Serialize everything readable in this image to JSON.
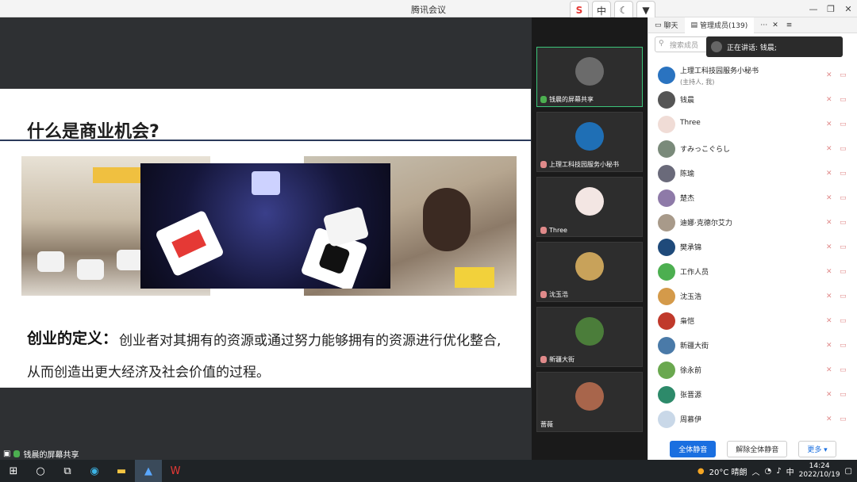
{
  "app_title": "腾讯会议",
  "toolbar_icons": [
    "s-icon",
    "中",
    "moon-icon",
    "shirt-icon"
  ],
  "window_controls": [
    "—",
    "❐",
    "✕"
  ],
  "slide": {
    "title": "什么是商业机会?",
    "def_label": "创业的定义：",
    "def_text": "创业者对其拥有的资源或通过努力能够拥有的资源进行优化整合,",
    "def_text2": "从而创造出更大经济及社会价值的过程。"
  },
  "video_tiles": [
    {
      "name": "钱晨的屏幕共享",
      "active": true,
      "color": "#6b6b6b"
    },
    {
      "name": "上理工科技园服务小秘书",
      "active": false,
      "color": "#1f6fb5"
    },
    {
      "name": "Three",
      "active": false,
      "color": "#f3e6e3"
    },
    {
      "name": "沈玉浩",
      "active": false,
      "color": "#c8a25a"
    },
    {
      "name": "新疆大街",
      "active": false,
      "color": "#4b7d3a"
    },
    {
      "name": "蔷薇",
      "active": false,
      "color": "#a8654b"
    }
  ],
  "members_panel": {
    "tab_chat": "聊天",
    "tab_members": "管理成员(139)",
    "search_placeholder": "搜索成员",
    "speaking": "正在讲话: 钱晨;",
    "members": [
      {
        "name": "上理工科技园服务小秘书",
        "sub": "(主持人, 我)",
        "color": "#2a73c0"
      },
      {
        "name": "钱晨",
        "sub": "",
        "color": "#555555"
      },
      {
        "name": "Three",
        "sub": "",
        "color": "#f0dcd6"
      },
      {
        "name": "すみっこぐらし",
        "sub": "",
        "color": "#7a8a7a"
      },
      {
        "name": "陈瑜",
        "sub": "",
        "color": "#6a6a7a"
      },
      {
        "name": "楚杰",
        "sub": "",
        "color": "#8e7aa8"
      },
      {
        "name": "迪娜·克德尔艾力",
        "sub": "",
        "color": "#a89a8a"
      },
      {
        "name": "樊承锦",
        "sub": "",
        "color": "#1f4a7a"
      },
      {
        "name": "工作人员",
        "sub": "",
        "color": "#4caf50"
      },
      {
        "name": "沈玉浩",
        "sub": "",
        "color": "#d49a4a"
      },
      {
        "name": "枭恺",
        "sub": "",
        "color": "#c0392b"
      },
      {
        "name": "新疆大街",
        "sub": "",
        "color": "#4a7aa8"
      },
      {
        "name": "徐永前",
        "sub": "",
        "color": "#6aa84f"
      },
      {
        "name": "张晋源",
        "sub": "",
        "color": "#2d8a6a"
      },
      {
        "name": "周慕伊",
        "sub": "",
        "color": "#c9d8e8"
      }
    ],
    "btn_mute_all": "全体静音",
    "btn_unmute_all": "解除全体静音",
    "btn_more": "更多 ▾"
  },
  "share_tag": "钱晨的屏幕共享",
  "taskbar": {
    "weather": "20°C 晴朗",
    "ime": "中",
    "time": "14:24",
    "date": "2022/10/19"
  }
}
